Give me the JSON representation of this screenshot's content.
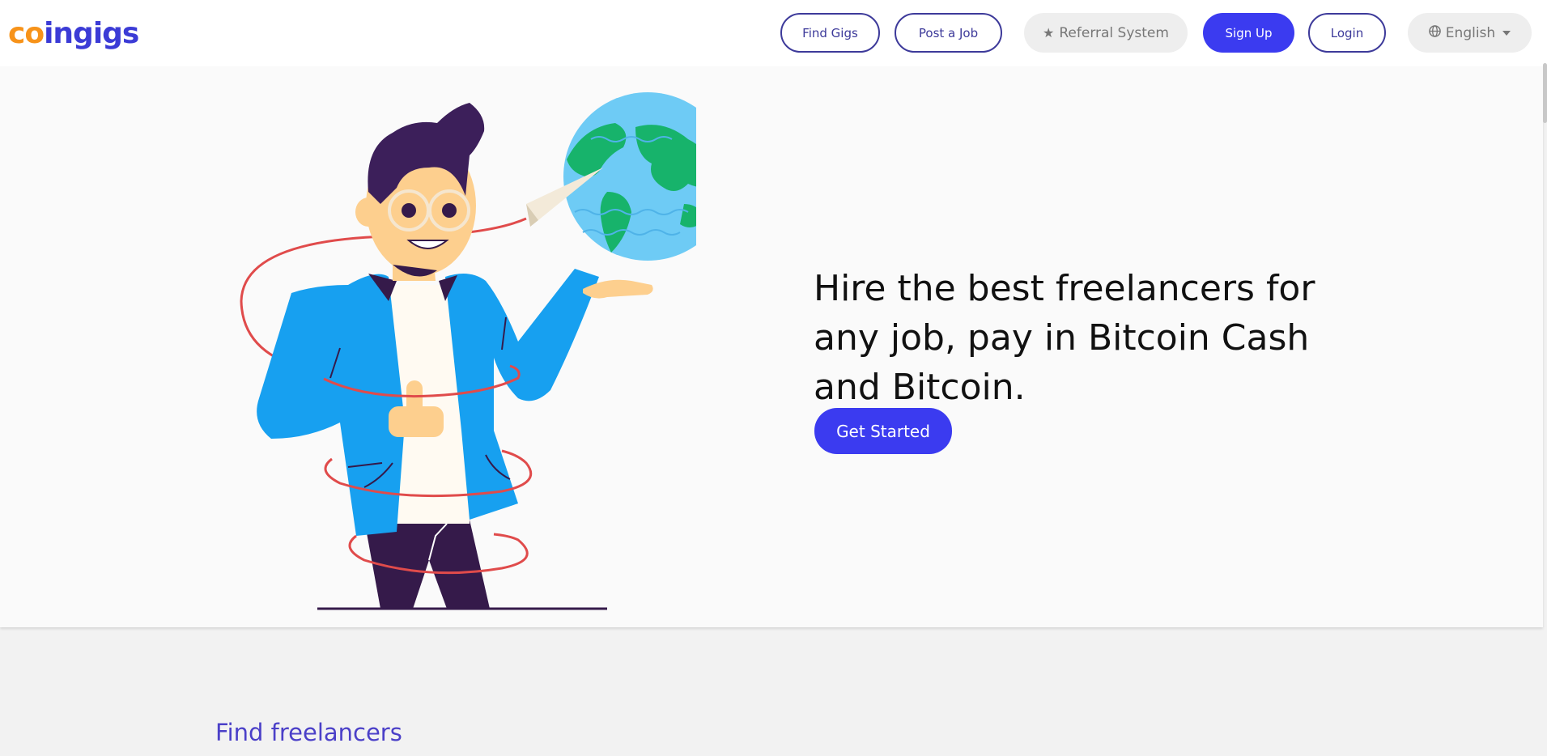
{
  "brand": {
    "logo_c": "c",
    "logo_o": "o",
    "logo_rest": "ingigs"
  },
  "nav": {
    "find_gigs": "Find Gigs",
    "post_job": "Post a Job",
    "referral": "Referral System",
    "sign_up": "Sign Up",
    "login": "Login",
    "language": "English"
  },
  "icons": {
    "referral": "star-icon",
    "language": "globe-icon",
    "dropdown": "caret-down-icon"
  },
  "hero": {
    "headline": "Hire the best freelancers for any job, pay in Bitcoin Cash and Bitcoin.",
    "cta": "Get Started"
  },
  "sections": {
    "find_freelancers": "Find freelancers"
  },
  "colors": {
    "accent": "#3b3bf0",
    "outline": "#3d3a9a",
    "logo_orange": "#f7931a",
    "section_title": "#4b40c8"
  }
}
